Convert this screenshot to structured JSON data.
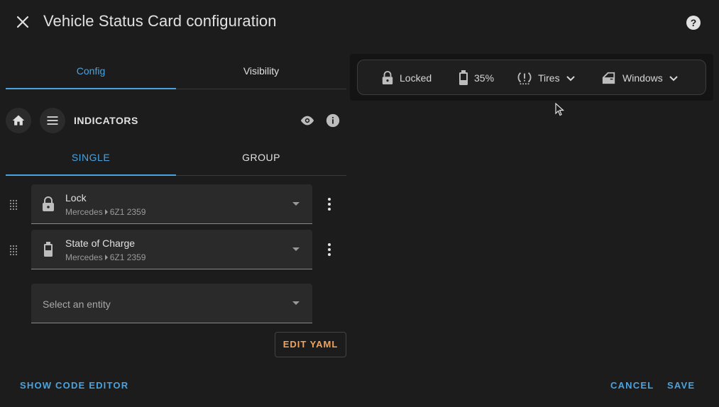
{
  "header": {
    "title": "Vehicle Status Card configuration"
  },
  "tabs": [
    {
      "label": "Config",
      "active": true
    },
    {
      "label": "Visibility",
      "active": false
    }
  ],
  "section": {
    "title": "INDICATORS"
  },
  "subtabs": [
    {
      "label": "SINGLE",
      "active": true
    },
    {
      "label": "GROUP",
      "active": false
    }
  ],
  "entities": [
    {
      "name": "Lock",
      "device": "Mercedes",
      "area": "6Z1 2359",
      "icon": "lock-icon"
    },
    {
      "name": "State of Charge",
      "device": "Mercedes",
      "area": "6Z1 2359",
      "icon": "battery-icon"
    }
  ],
  "entity_picker": {
    "placeholder": "Select an entity"
  },
  "edit_yaml_label": "EDIT YAML",
  "footer": {
    "show_code_editor": "SHOW CODE EDITOR",
    "cancel": "CANCEL",
    "save": "SAVE"
  },
  "preview": {
    "indicators": [
      {
        "icon": "lock-icon",
        "label": "Locked"
      },
      {
        "icon": "battery-icon",
        "label": "35%"
      },
      {
        "icon": "tire-alert-icon",
        "label": "Tires",
        "dropdown": true
      },
      {
        "icon": "car-door-icon",
        "label": "Windows",
        "dropdown": true
      }
    ]
  },
  "colors": {
    "accent": "#4aa3df",
    "warning_text": "#f1a45c",
    "background": "#1c1c1c"
  }
}
